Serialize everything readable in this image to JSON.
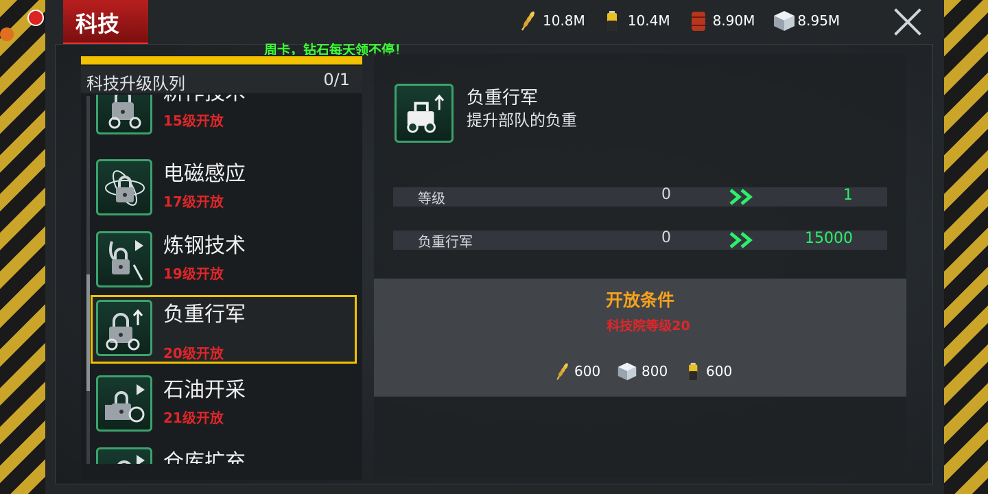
{
  "header": {
    "title": "科技",
    "close_icon": "close-icon",
    "promo": "周卡，钻石每天领不停！"
  },
  "resources": [
    {
      "name": "wheat-icon",
      "value": "10.8M"
    },
    {
      "name": "battery-icon",
      "value": "10.4M"
    },
    {
      "name": "oil-barrel-icon",
      "value": "8.90M"
    },
    {
      "name": "steel-cube-icon",
      "value": "8.95M"
    }
  ],
  "queue": {
    "label": "科技升级队列",
    "count": "0/1"
  },
  "tech_list": [
    {
      "name": "耕作技术",
      "req": "15级开放",
      "icon": "tractor-icon"
    },
    {
      "name": "电磁感应",
      "req": "17级开放",
      "icon": "atom-icon"
    },
    {
      "name": "炼钢技术",
      "req": "19级开放",
      "icon": "crane-icon"
    },
    {
      "name": "负重行军",
      "req": "20级开放",
      "icon": "truck-upgrade-icon",
      "selected": true
    },
    {
      "name": "石油开采",
      "req": "21级开放",
      "icon": "oil-pump-icon"
    },
    {
      "name": "仓库扩充",
      "req": "",
      "icon": "warehouse-icon"
    }
  ],
  "detail": {
    "name": "负重行军",
    "description": "提升部队的负重",
    "stats": [
      {
        "label": "等级",
        "current": "0",
        "next": "1"
      },
      {
        "label": "负重行军",
        "current": "0",
        "next": "15000"
      }
    ],
    "condition_title": "开放条件",
    "condition_req": "科技院等级20",
    "costs": [
      {
        "name": "wheat-icon",
        "value": "600"
      },
      {
        "name": "steel-cube-icon",
        "value": "800"
      },
      {
        "name": "battery-icon",
        "value": "600"
      }
    ]
  },
  "colors": {
    "accent_red": "#b81f1f",
    "highlight_yellow": "#f2c200",
    "tile_green": "#3ca26d",
    "next_value_green": "#2cf06a",
    "requirement_red": "#e0262a",
    "condition_orange": "#f7a21c"
  }
}
